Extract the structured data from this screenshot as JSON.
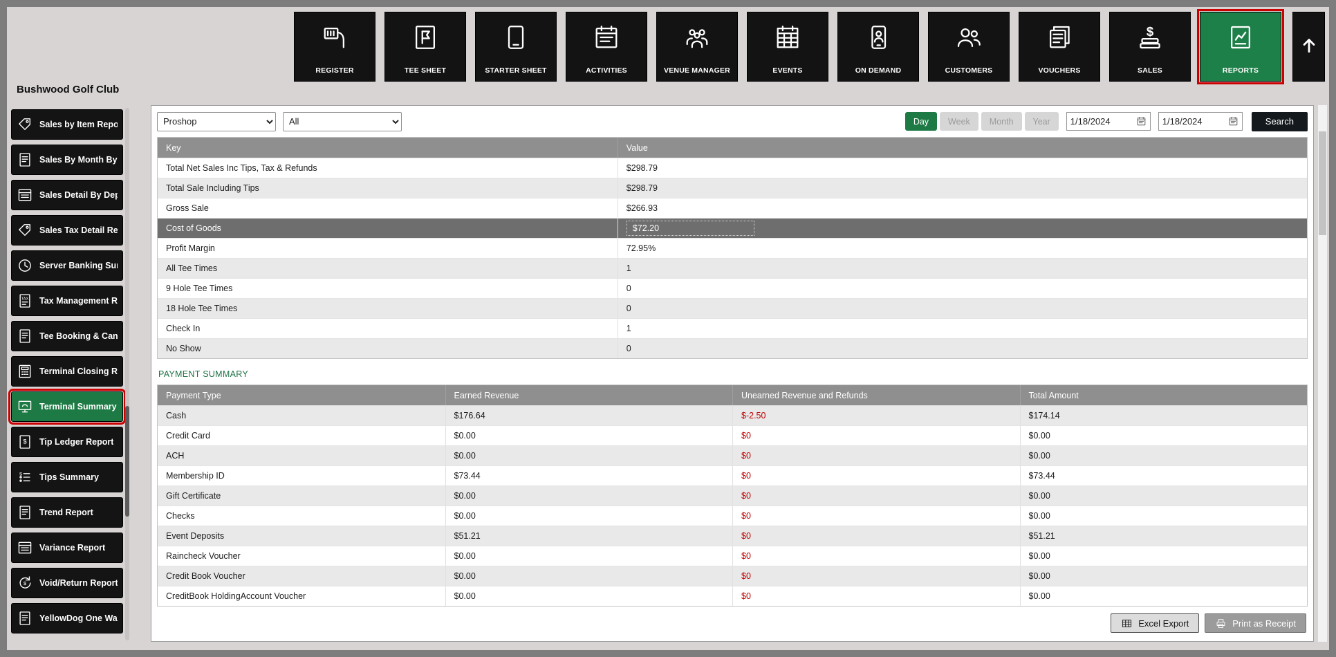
{
  "brand": "Bushwood Golf Club",
  "colors": {
    "accent_green": "#1E8049",
    "highlight_red": "#CC0000",
    "negative_red": "#C00000",
    "table_header_gray": "#8F8F8F",
    "selected_row_gray": "#6E6E6E"
  },
  "app_nav": {
    "items": [
      {
        "label": "REGISTER",
        "icon": "barcode-scanner-icon",
        "active": false
      },
      {
        "label": "TEE SHEET",
        "icon": "tee-sheet-icon",
        "active": false
      },
      {
        "label": "STARTER SHEET",
        "icon": "tablet-icon",
        "active": false
      },
      {
        "label": "ACTIVITIES",
        "icon": "calendar-icon",
        "active": false
      },
      {
        "label": "VENUE MANAGER",
        "icon": "venue-manager-icon",
        "active": false
      },
      {
        "label": "EVENTS",
        "icon": "events-icon",
        "active": false
      },
      {
        "label": "ON DEMAND",
        "icon": "on-demand-icon",
        "active": false
      },
      {
        "label": "CUSTOMERS",
        "icon": "customers-icon",
        "active": false
      },
      {
        "label": "VOUCHERS",
        "icon": "vouchers-icon",
        "active": false
      },
      {
        "label": "SALES",
        "icon": "sales-icon",
        "active": false
      },
      {
        "label": "REPORTS",
        "icon": "reports-icon",
        "active": true
      }
    ]
  },
  "sidebar": {
    "items": [
      {
        "label": "Sales by Item Report",
        "icon": "sale-tag-icon",
        "active": false
      },
      {
        "label": "Sales By Month By S...",
        "icon": "doc-report-icon",
        "active": false
      },
      {
        "label": "Sales Detail By Depar...",
        "icon": "list-doc-icon",
        "active": false
      },
      {
        "label": "Sales Tax Detail Report",
        "icon": "sale-tag-icon",
        "active": false
      },
      {
        "label": "Server Banking Sum...",
        "icon": "clock-icon",
        "active": false
      },
      {
        "label": "Tax Management Re...",
        "icon": "tax-doc-icon",
        "active": false
      },
      {
        "label": "Tee Booking & Cance...",
        "icon": "doc-report-icon",
        "active": false
      },
      {
        "label": "Terminal Closing Rep...",
        "icon": "register-icon",
        "active": false
      },
      {
        "label": "Terminal Summary",
        "icon": "monitor-icon",
        "active": true
      },
      {
        "label": "Tip Ledger Report",
        "icon": "ledger-icon",
        "active": false
      },
      {
        "label": "Tips Summary",
        "icon": "tips-list-icon",
        "active": false
      },
      {
        "label": "Trend Report",
        "icon": "doc-report-icon",
        "active": false
      },
      {
        "label": "Variance Report",
        "icon": "list-doc-icon",
        "active": false
      },
      {
        "label": "Void/Return Report",
        "icon": "void-return-icon",
        "active": false
      },
      {
        "label": "YellowDog One Way...",
        "icon": "doc-report-icon",
        "active": false
      }
    ]
  },
  "filters": {
    "department": "Proshop",
    "terminal": "All",
    "period_buttons": [
      "Day",
      "Week",
      "Month",
      "Year"
    ],
    "active_period": "Day",
    "date_from": "1/18/2024",
    "date_to": "1/18/2024",
    "search_label": "Search"
  },
  "summary_table": {
    "headers": [
      "Key",
      "Value"
    ],
    "selected_index": 3,
    "rows": [
      {
        "key": "Total Net Sales Inc Tips, Tax & Refunds",
        "value": "$298.79"
      },
      {
        "key": "Total Sale Including Tips",
        "value": "$298.79"
      },
      {
        "key": "Gross Sale",
        "value": "$266.93"
      },
      {
        "key": "Cost of Goods",
        "value": "$72.20"
      },
      {
        "key": "Profit Margin",
        "value": "72.95%"
      },
      {
        "key": "All Tee Times",
        "value": "1"
      },
      {
        "key": "9 Hole Tee Times",
        "value": "0"
      },
      {
        "key": "18 Hole Tee Times",
        "value": "0"
      },
      {
        "key": "Check In",
        "value": "1"
      },
      {
        "key": "No Show",
        "value": "0"
      }
    ]
  },
  "payment_summary": {
    "title": "PAYMENT SUMMARY",
    "headers": [
      "Payment Type",
      "Earned Revenue",
      "Unearned Revenue and Refunds",
      "Total Amount"
    ],
    "rows": [
      {
        "type": "Cash",
        "earned": "$176.64",
        "unearned": "$-2.50",
        "total": "$174.14"
      },
      {
        "type": "Credit Card",
        "earned": "$0.00",
        "unearned": "$0",
        "total": "$0.00"
      },
      {
        "type": "ACH",
        "earned": "$0.00",
        "unearned": "$0",
        "total": "$0.00"
      },
      {
        "type": "Membership ID",
        "earned": "$73.44",
        "unearned": "$0",
        "total": "$73.44"
      },
      {
        "type": "Gift Certificate",
        "earned": "$0.00",
        "unearned": "$0",
        "total": "$0.00"
      },
      {
        "type": "Checks",
        "earned": "$0.00",
        "unearned": "$0",
        "total": "$0.00"
      },
      {
        "type": "Event Deposits",
        "earned": "$51.21",
        "unearned": "$0",
        "total": "$51.21"
      },
      {
        "type": "Raincheck Voucher",
        "earned": "$0.00",
        "unearned": "$0",
        "total": "$0.00"
      },
      {
        "type": "Credit Book Voucher",
        "earned": "$0.00",
        "unearned": "$0",
        "total": "$0.00"
      },
      {
        "type": "CreditBook HoldingAccount Voucher",
        "earned": "$0.00",
        "unearned": "$0",
        "total": "$0.00"
      }
    ]
  },
  "footer": {
    "excel_export": "Excel Export",
    "print_receipt": "Print as Receipt"
  }
}
